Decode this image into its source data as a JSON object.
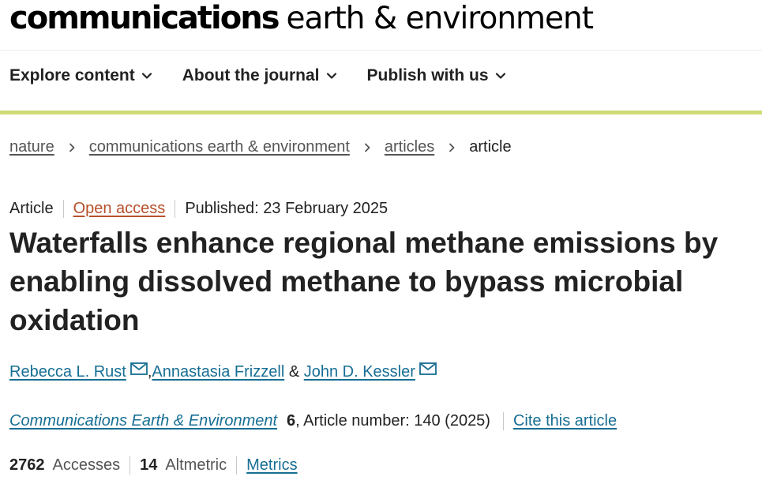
{
  "site": {
    "logo_bold": "communications",
    "logo_light": "earth & environment"
  },
  "nav": {
    "items": [
      {
        "label": "Explore content"
      },
      {
        "label": "About the journal"
      },
      {
        "label": "Publish with us"
      }
    ]
  },
  "breadcrumb": {
    "items": [
      "nature",
      "communications earth & environment",
      "articles"
    ],
    "current": "article"
  },
  "article": {
    "type": "Article",
    "access": "Open access",
    "published": "Published: 23 February 2025",
    "title": "Waterfalls enhance regional methane emissions by enabling dissolved methane to bypass microbial oxidation",
    "authors": [
      {
        "name": "Rebecca L. Rust",
        "mail_icon": "envelope-icon",
        "sep": ", "
      },
      {
        "name": "Annastasia Frizzell",
        "sep": " & "
      },
      {
        "name": "John D. Kessler",
        "mail_icon": "envelope-icon"
      }
    ],
    "citation": {
      "journal": "Communications Earth & Environment",
      "volume": "6",
      "rest": ", Article number: 140 (2025)",
      "cite_link": "Cite this article"
    },
    "metrics": {
      "accesses_value": "2762",
      "accesses_label": "Accesses",
      "altmetric_value": "14",
      "altmetric_label": "Altmetric",
      "metrics_link": "Metrics"
    }
  },
  "colors": {
    "accent_bar": "#cedb76",
    "link": "#176e94",
    "open_access": "#b7502a"
  }
}
